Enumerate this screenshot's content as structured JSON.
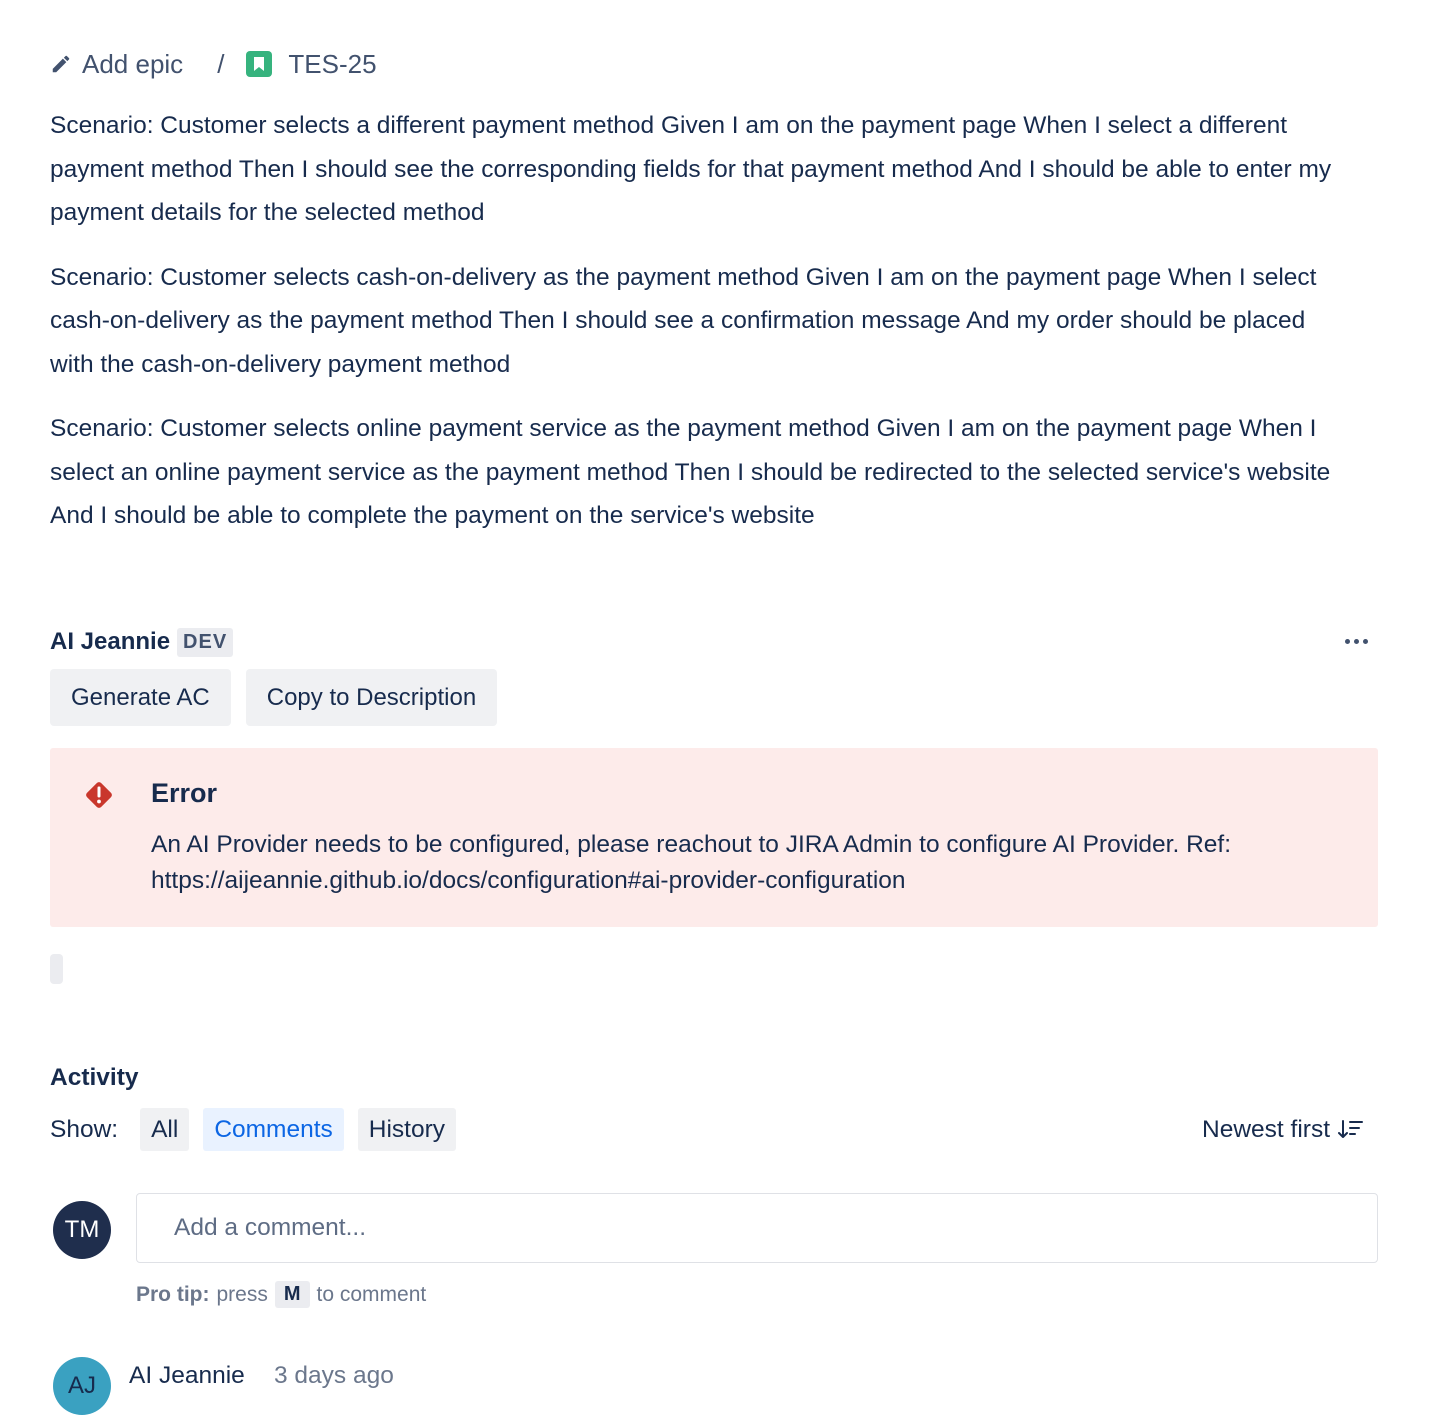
{
  "breadcrumb": {
    "add_epic": "Add epic",
    "separator": "/",
    "issue_key": "TES-25"
  },
  "description": {
    "paragraphs": [
      "Scenario: Customer selects a different payment method Given I am on the payment page When I select a different payment method Then I should see the corresponding fields for that payment method And I should be able to enter my payment details for the selected method",
      "Scenario: Customer selects cash-on-delivery as the payment method Given I am on the payment page When I select cash-on-delivery as the payment method Then I should see a confirmation message And my order should be placed with the cash-on-delivery payment method",
      "Scenario: Customer selects online payment service as the payment method Given I am on the payment page When I select an online payment service as the payment method Then I should be redirected to the selected service's website And I should be able to complete the payment on the service's website"
    ]
  },
  "ai_panel": {
    "title": "AI Jeannie",
    "badge": "DEV",
    "buttons": {
      "generate": "Generate AC",
      "copy": "Copy to Description"
    },
    "error": {
      "title": "Error",
      "message": "An AI Provider needs to be configured, please reachout to JIRA Admin to configure AI Provider. Ref: https://aijeannie.github.io/docs/configuration#ai-provider-configuration"
    }
  },
  "activity": {
    "title": "Activity",
    "show_label": "Show:",
    "filters": [
      "All",
      "Comments",
      "History"
    ],
    "active_filter": "Comments",
    "sort_label": "Newest first",
    "comment_placeholder": "Add a comment...",
    "pro_tip": {
      "label": "Pro tip:",
      "before": "press",
      "key": "M",
      "after": "to comment"
    },
    "current_user_initials": "TM",
    "comments": [
      {
        "initials": "AJ",
        "author": "AI Jeannie",
        "time": "3 days ago"
      }
    ]
  },
  "colors": {
    "text": "#172b4d",
    "story_icon": "#36b37e",
    "error_bg": "#fdebea",
    "error_icon": "#c9372c",
    "active_filter_bg": "#e9f2ff",
    "active_filter_text": "#0c66e4",
    "avatar_tm": "#1f2e4d",
    "avatar_aj": "#3aa1c1"
  }
}
